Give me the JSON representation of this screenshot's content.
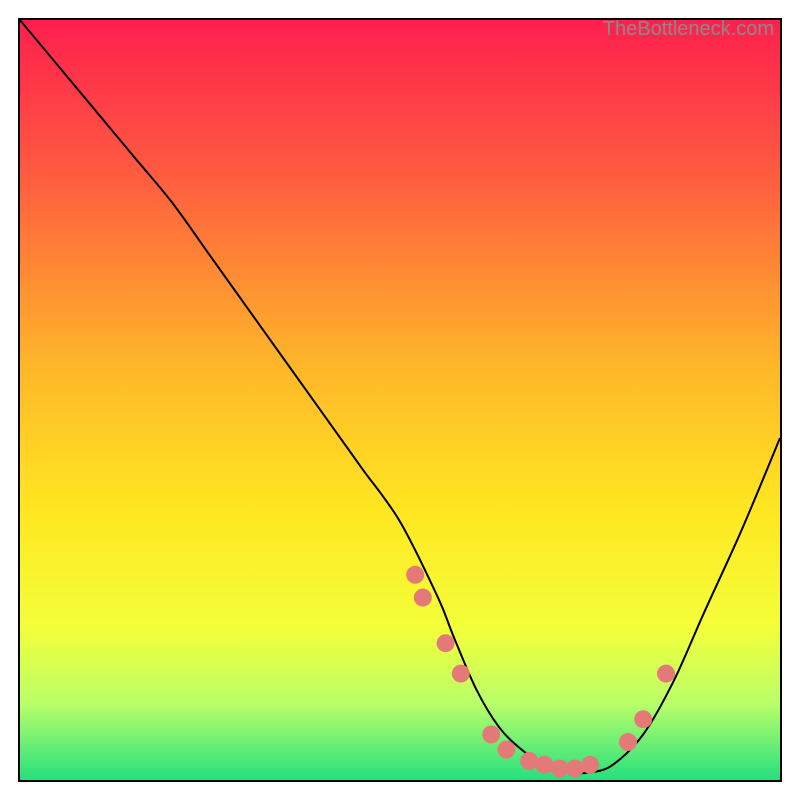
{
  "watermark": "TheBottleneck.com",
  "chart_data": {
    "type": "line",
    "title": "",
    "xlabel": "",
    "ylabel": "",
    "xlim": [
      0,
      100
    ],
    "ylim": [
      0,
      100
    ],
    "series": [
      {
        "name": "bottleneck-curve",
        "x": [
          0,
          5,
          10,
          15,
          20,
          25,
          30,
          35,
          40,
          45,
          50,
          55,
          57,
          60,
          63,
          66,
          69,
          72,
          75,
          78,
          82,
          86,
          90,
          95,
          100
        ],
        "y": [
          100,
          94,
          88,
          82,
          76,
          69,
          62,
          55,
          48,
          41,
          34,
          24,
          19,
          12,
          7,
          4,
          2,
          1,
          1,
          2,
          6,
          13,
          22,
          33,
          45
        ]
      }
    ],
    "markers": {
      "name": "highlight-dots",
      "color": "#e47a78",
      "x": [
        52,
        53,
        56,
        58,
        62,
        64,
        67,
        69,
        71,
        73,
        75,
        80,
        82,
        85
      ],
      "y": [
        27,
        24,
        18,
        14,
        6,
        4,
        2.5,
        2,
        1.5,
        1.5,
        2,
        5,
        8,
        14
      ]
    },
    "gradient_stops": [
      {
        "pos": 0.0,
        "color": "#ff1f4e"
      },
      {
        "pos": 0.2,
        "color": "#ff5a40"
      },
      {
        "pos": 0.45,
        "color": "#ffb52a"
      },
      {
        "pos": 0.65,
        "color": "#ffe821"
      },
      {
        "pos": 0.8,
        "color": "#f3ff3a"
      },
      {
        "pos": 0.9,
        "color": "#b9ff6a"
      },
      {
        "pos": 1.0,
        "color": "#25e07e"
      }
    ]
  }
}
